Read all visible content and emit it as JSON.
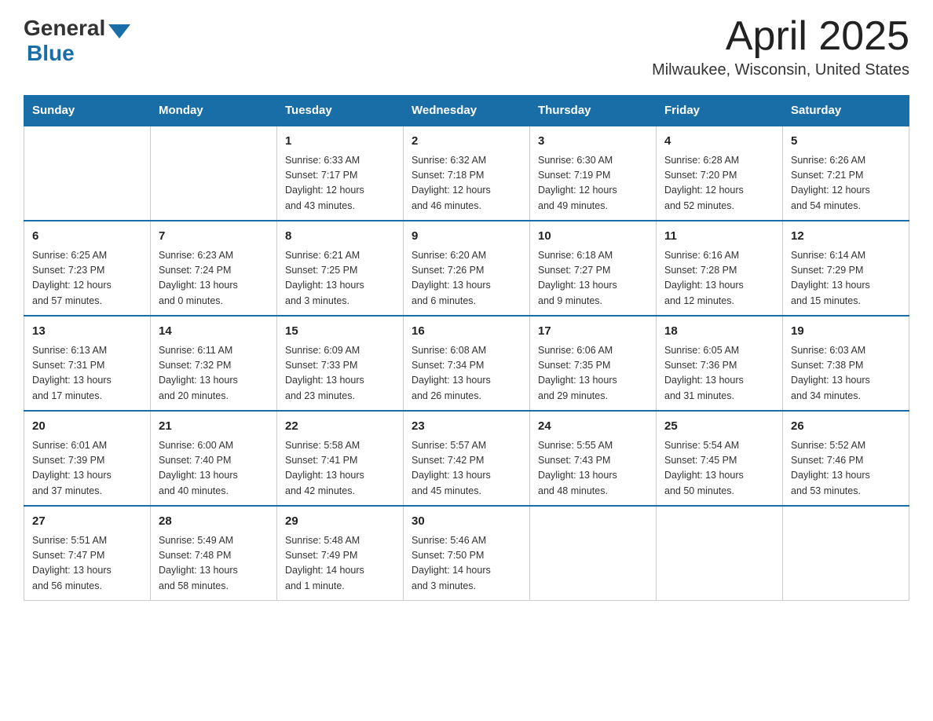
{
  "header": {
    "logo_general": "General",
    "logo_blue": "Blue",
    "month_title": "April 2025",
    "location": "Milwaukee, Wisconsin, United States"
  },
  "weekdays": [
    "Sunday",
    "Monday",
    "Tuesday",
    "Wednesday",
    "Thursday",
    "Friday",
    "Saturday"
  ],
  "weeks": [
    [
      {
        "day": "",
        "info": ""
      },
      {
        "day": "",
        "info": ""
      },
      {
        "day": "1",
        "info": "Sunrise: 6:33 AM\nSunset: 7:17 PM\nDaylight: 12 hours\nand 43 minutes."
      },
      {
        "day": "2",
        "info": "Sunrise: 6:32 AM\nSunset: 7:18 PM\nDaylight: 12 hours\nand 46 minutes."
      },
      {
        "day": "3",
        "info": "Sunrise: 6:30 AM\nSunset: 7:19 PM\nDaylight: 12 hours\nand 49 minutes."
      },
      {
        "day": "4",
        "info": "Sunrise: 6:28 AM\nSunset: 7:20 PM\nDaylight: 12 hours\nand 52 minutes."
      },
      {
        "day": "5",
        "info": "Sunrise: 6:26 AM\nSunset: 7:21 PM\nDaylight: 12 hours\nand 54 minutes."
      }
    ],
    [
      {
        "day": "6",
        "info": "Sunrise: 6:25 AM\nSunset: 7:23 PM\nDaylight: 12 hours\nand 57 minutes."
      },
      {
        "day": "7",
        "info": "Sunrise: 6:23 AM\nSunset: 7:24 PM\nDaylight: 13 hours\nand 0 minutes."
      },
      {
        "day": "8",
        "info": "Sunrise: 6:21 AM\nSunset: 7:25 PM\nDaylight: 13 hours\nand 3 minutes."
      },
      {
        "day": "9",
        "info": "Sunrise: 6:20 AM\nSunset: 7:26 PM\nDaylight: 13 hours\nand 6 minutes."
      },
      {
        "day": "10",
        "info": "Sunrise: 6:18 AM\nSunset: 7:27 PM\nDaylight: 13 hours\nand 9 minutes."
      },
      {
        "day": "11",
        "info": "Sunrise: 6:16 AM\nSunset: 7:28 PM\nDaylight: 13 hours\nand 12 minutes."
      },
      {
        "day": "12",
        "info": "Sunrise: 6:14 AM\nSunset: 7:29 PM\nDaylight: 13 hours\nand 15 minutes."
      }
    ],
    [
      {
        "day": "13",
        "info": "Sunrise: 6:13 AM\nSunset: 7:31 PM\nDaylight: 13 hours\nand 17 minutes."
      },
      {
        "day": "14",
        "info": "Sunrise: 6:11 AM\nSunset: 7:32 PM\nDaylight: 13 hours\nand 20 minutes."
      },
      {
        "day": "15",
        "info": "Sunrise: 6:09 AM\nSunset: 7:33 PM\nDaylight: 13 hours\nand 23 minutes."
      },
      {
        "day": "16",
        "info": "Sunrise: 6:08 AM\nSunset: 7:34 PM\nDaylight: 13 hours\nand 26 minutes."
      },
      {
        "day": "17",
        "info": "Sunrise: 6:06 AM\nSunset: 7:35 PM\nDaylight: 13 hours\nand 29 minutes."
      },
      {
        "day": "18",
        "info": "Sunrise: 6:05 AM\nSunset: 7:36 PM\nDaylight: 13 hours\nand 31 minutes."
      },
      {
        "day": "19",
        "info": "Sunrise: 6:03 AM\nSunset: 7:38 PM\nDaylight: 13 hours\nand 34 minutes."
      }
    ],
    [
      {
        "day": "20",
        "info": "Sunrise: 6:01 AM\nSunset: 7:39 PM\nDaylight: 13 hours\nand 37 minutes."
      },
      {
        "day": "21",
        "info": "Sunrise: 6:00 AM\nSunset: 7:40 PM\nDaylight: 13 hours\nand 40 minutes."
      },
      {
        "day": "22",
        "info": "Sunrise: 5:58 AM\nSunset: 7:41 PM\nDaylight: 13 hours\nand 42 minutes."
      },
      {
        "day": "23",
        "info": "Sunrise: 5:57 AM\nSunset: 7:42 PM\nDaylight: 13 hours\nand 45 minutes."
      },
      {
        "day": "24",
        "info": "Sunrise: 5:55 AM\nSunset: 7:43 PM\nDaylight: 13 hours\nand 48 minutes."
      },
      {
        "day": "25",
        "info": "Sunrise: 5:54 AM\nSunset: 7:45 PM\nDaylight: 13 hours\nand 50 minutes."
      },
      {
        "day": "26",
        "info": "Sunrise: 5:52 AM\nSunset: 7:46 PM\nDaylight: 13 hours\nand 53 minutes."
      }
    ],
    [
      {
        "day": "27",
        "info": "Sunrise: 5:51 AM\nSunset: 7:47 PM\nDaylight: 13 hours\nand 56 minutes."
      },
      {
        "day": "28",
        "info": "Sunrise: 5:49 AM\nSunset: 7:48 PM\nDaylight: 13 hours\nand 58 minutes."
      },
      {
        "day": "29",
        "info": "Sunrise: 5:48 AM\nSunset: 7:49 PM\nDaylight: 14 hours\nand 1 minute."
      },
      {
        "day": "30",
        "info": "Sunrise: 5:46 AM\nSunset: 7:50 PM\nDaylight: 14 hours\nand 3 minutes."
      },
      {
        "day": "",
        "info": ""
      },
      {
        "day": "",
        "info": ""
      },
      {
        "day": "",
        "info": ""
      }
    ]
  ]
}
